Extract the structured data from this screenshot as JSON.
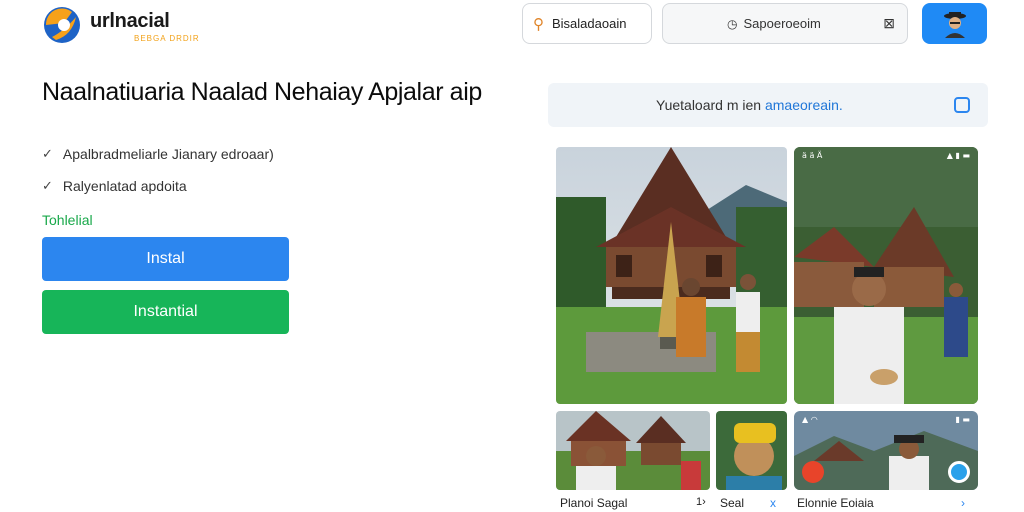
{
  "header": {
    "logo_text": "urlnacial",
    "logo_tagline": "BEBGA DRDIR",
    "search_label": "Bisaladaoain",
    "filter_label": "Sapoeroeoim",
    "avatar_alt": "user"
  },
  "hero": {
    "title": "Naalnatiuaria Naalad Nehaiay Apjalar aip",
    "features": [
      "Apalbradmeliarle Jianary edroaar)",
      "Ralyenlatad apdoita"
    ],
    "subhead": "Tohlelial",
    "install_label": "Instal",
    "instant_label": "Instantial"
  },
  "banner": {
    "text": "Yuetaloard m ien",
    "accent_text": "amaeoreain."
  },
  "gallery": {
    "status_left": "ä ä Ä",
    "captions": {
      "c1": "Planoi Sagal",
      "c1_num": "1›",
      "c2": "Seal",
      "c2_close": "x",
      "c3": "Elonnie Eoiaia",
      "c3_arrow": "›"
    }
  },
  "colors": {
    "primary": "#2c86ef",
    "success": "#17b559",
    "accent_orange": "#f2a21a"
  }
}
